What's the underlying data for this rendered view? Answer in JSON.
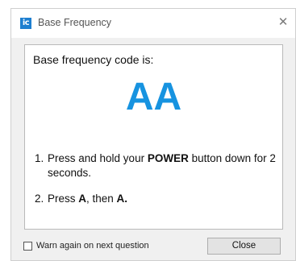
{
  "window": {
    "title": "Base Frequency",
    "app_icon_label": "ic",
    "close_glyph": "✕"
  },
  "content": {
    "heading": "Base frequency code is:",
    "code": "AA",
    "steps": [
      {
        "number": "1.",
        "pre": "Press and hold your ",
        "bold": "POWER",
        "post": " button down for 2 seconds."
      },
      {
        "number": "2.",
        "pre": "Press ",
        "bold1": "A",
        "mid": ", then ",
        "bold2": "A."
      }
    ]
  },
  "footer": {
    "checkbox_label": "Warn again on next question",
    "checkbox_checked": false,
    "close_button_label": "Close"
  },
  "colors": {
    "accent": "#1793e0",
    "app_icon": "#1e7fd0"
  }
}
